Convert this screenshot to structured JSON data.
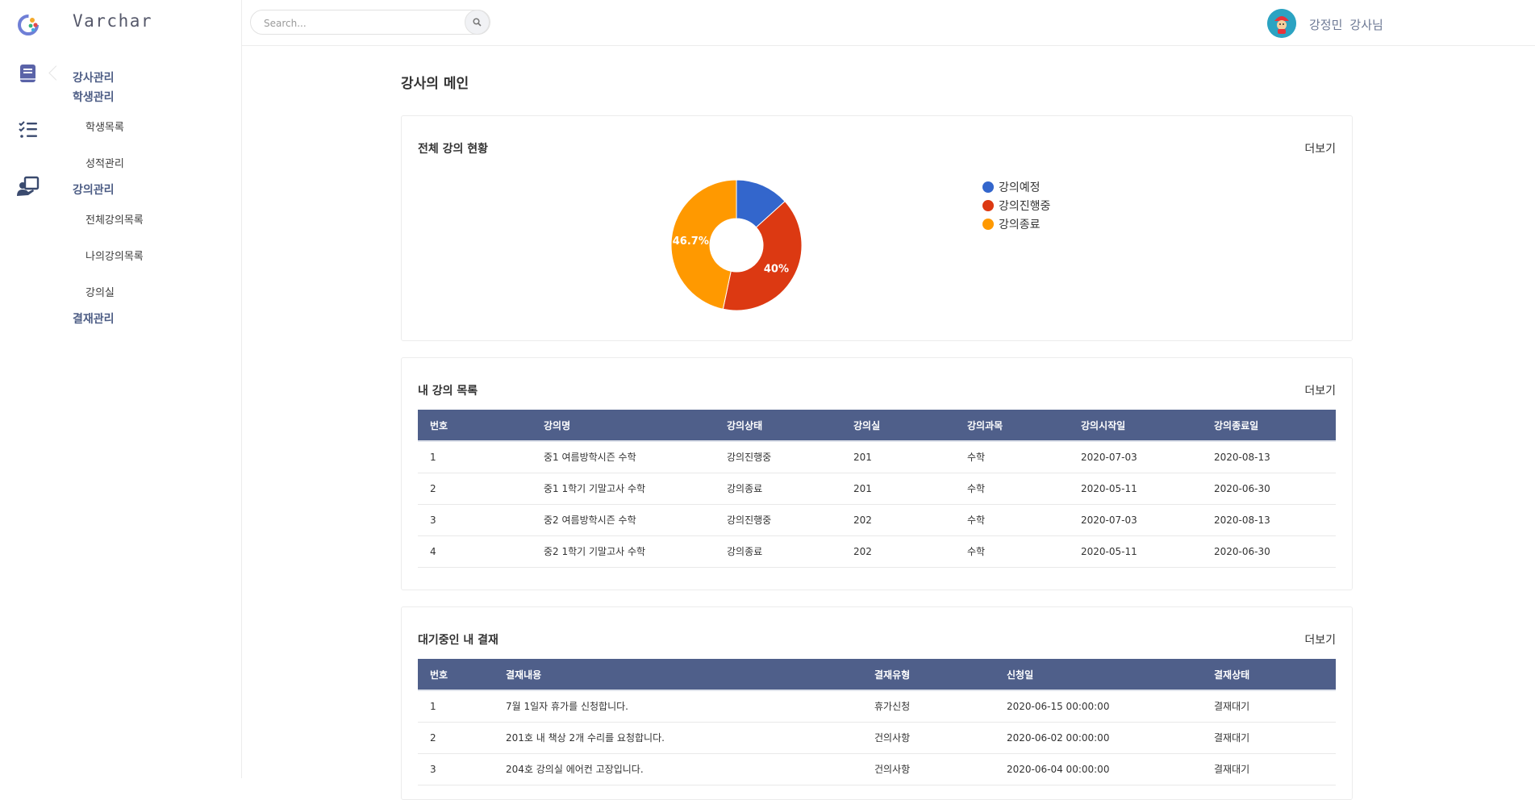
{
  "app": {
    "name": "Varchar"
  },
  "search": {
    "placeholder": "Search..."
  },
  "user": {
    "name": "강정민",
    "role": "강사님"
  },
  "sidebar": {
    "rail_icons": [
      "book-icon",
      "checklist-icon",
      "teacher-icon"
    ],
    "groups": [
      {
        "label": "강사관리",
        "items": []
      },
      {
        "label": "학생관리",
        "items": [
          "학생목록",
          "성적관리"
        ]
      },
      {
        "label": "강의관리",
        "items": [
          "전체강의목록",
          "나의강의목록",
          "강의실"
        ]
      },
      {
        "label": "결재관리",
        "items": []
      }
    ]
  },
  "page": {
    "title": "강사의 메인"
  },
  "overview": {
    "title": "전체 강의 현황",
    "more": "더보기",
    "labels": {
      "in_progress": "40%",
      "ended": "46.7%"
    }
  },
  "chart_data": {
    "type": "pie",
    "categories": [
      "강의예정",
      "강의진행중",
      "강의종료"
    ],
    "values": [
      13.3,
      40,
      46.7
    ],
    "colors": [
      "#3366cc",
      "#dc3912",
      "#ff9900"
    ],
    "data_labels": [
      "",
      "40%",
      "46.7%"
    ],
    "donut": true,
    "legend_position": "right"
  },
  "lectures": {
    "title": "내 강의 목록",
    "more": "더보기",
    "headers": [
      "번호",
      "강의명",
      "강의상태",
      "강의실",
      "강의과목",
      "강의시작일",
      "강의종료일"
    ],
    "rows": [
      [
        "1",
        "중1 여름방학시즌 수학",
        "강의진행중",
        "201",
        "수학",
        "2020-07-03",
        "2020-08-13"
      ],
      [
        "2",
        "중1 1학기 기말고사 수학",
        "강의종료",
        "201",
        "수학",
        "2020-05-11",
        "2020-06-30"
      ],
      [
        "3",
        "중2 여름방학시즌 수학",
        "강의진행중",
        "202",
        "수학",
        "2020-07-03",
        "2020-08-13"
      ],
      [
        "4",
        "중2 1학기 기말고사 수학",
        "강의종료",
        "202",
        "수학",
        "2020-05-11",
        "2020-06-30"
      ]
    ]
  },
  "approvals": {
    "title": "대기중인 내 결재",
    "more": "더보기",
    "headers": [
      "번호",
      "결재내용",
      "결재유형",
      "신청일",
      "결재상태"
    ],
    "rows": [
      [
        "1",
        "7월 1일자 휴가를 신청합니다.",
        "휴가신청",
        "2020-06-15 00:00:00",
        "결재대기"
      ],
      [
        "2",
        "201호 내 책상 2개 수리를 요청합니다.",
        "건의사항",
        "2020-06-02 00:00:00",
        "결재대기"
      ],
      [
        "3",
        "204호 강의실 에어컨 고장입니다.",
        "건의사항",
        "2020-06-04 00:00:00",
        "결재대기"
      ]
    ]
  }
}
